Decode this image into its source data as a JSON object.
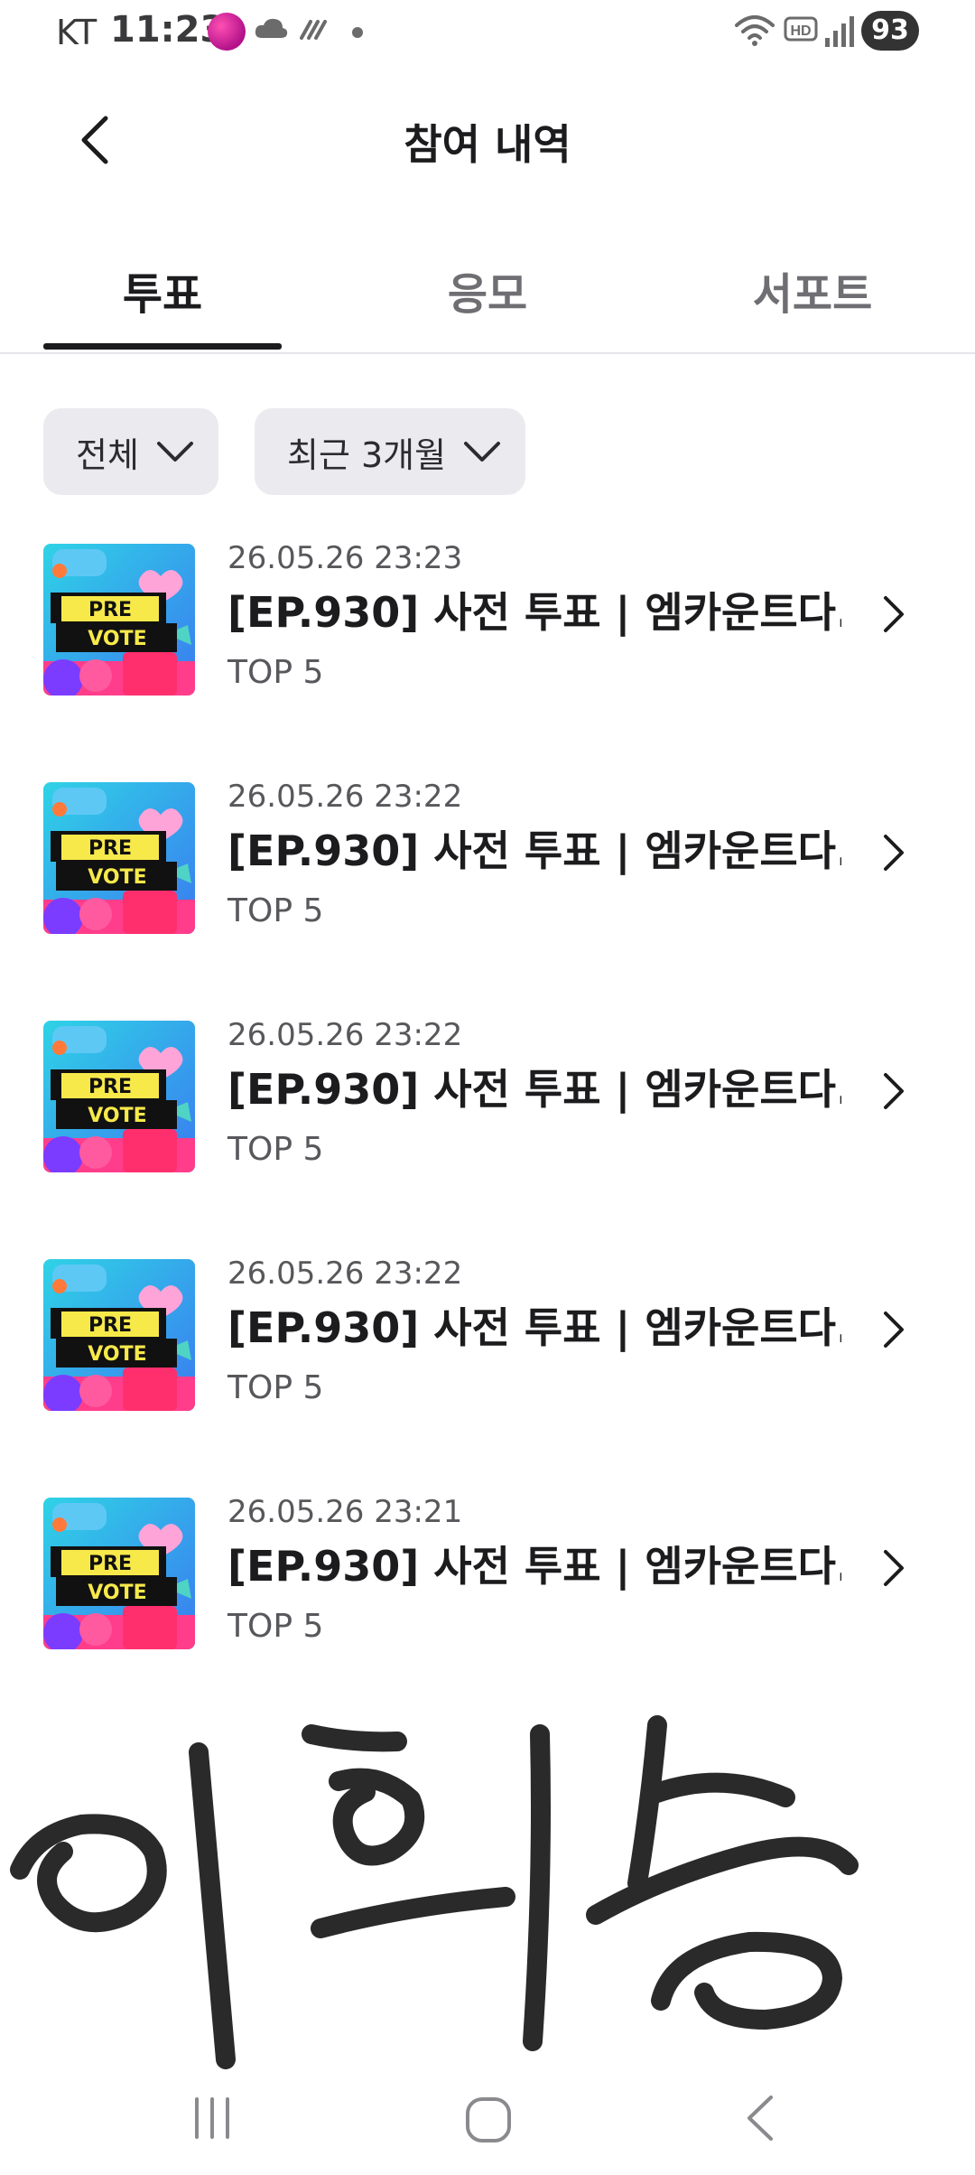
{
  "status_bar": {
    "carrier": "KT",
    "time": "11:23",
    "battery": "93",
    "icons": [
      "app-notification-icon",
      "cloud-icon",
      "hatch-icon",
      "dot-icon",
      "wifi-icon",
      "hd-icon",
      "signal-icon",
      "battery-icon"
    ]
  },
  "header": {
    "title": "참여 내역",
    "back_icon": "chevron-left-icon"
  },
  "tabs": [
    {
      "label": "투표",
      "active": true
    },
    {
      "label": "응모",
      "active": false
    },
    {
      "label": "서포트",
      "active": false
    }
  ],
  "filters": {
    "type": "전체",
    "period": "최근 3개월"
  },
  "thumbnail": {
    "line1": "PRE",
    "line2": "VOTE"
  },
  "items": [
    {
      "date": "26.05.26 23:23",
      "title": "[EP.930] 사전 투표 | 엠카운트다...",
      "subtitle": "TOP 5"
    },
    {
      "date": "26.05.26 23:22",
      "title": "[EP.930] 사전 투표 | 엠카운트다...",
      "subtitle": "TOP 5"
    },
    {
      "date": "26.05.26 23:22",
      "title": "[EP.930] 사전 투표 | 엠카운트다...",
      "subtitle": "TOP 5"
    },
    {
      "date": "26.05.26 23:22",
      "title": "[EP.930] 사전 투표 | 엠카운트다...",
      "subtitle": "TOP 5"
    },
    {
      "date": "26.05.26 23:21",
      "title": "[EP.930] 사전 투표 | 엠카운트다...",
      "subtitle": "TOP 5"
    }
  ],
  "signature": {
    "text": "이희승"
  },
  "nav_bar": {
    "icons": [
      "recent-apps-icon",
      "home-icon",
      "back-icon"
    ]
  },
  "colors": {
    "text_primary": "#1c1c1e",
    "text_secondary": "#58585c",
    "filter_bg": "#ebebef",
    "divider": "#e5e5ea"
  }
}
